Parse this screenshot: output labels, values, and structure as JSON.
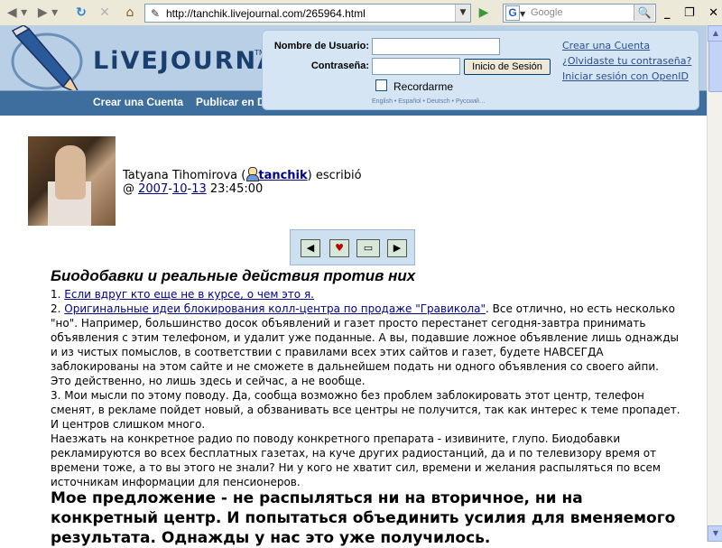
{
  "browser": {
    "url": "http://tanchik.livejournal.com/265964.html",
    "search_placeholder": "Google",
    "search_engine_letter": "G"
  },
  "header": {
    "logo": "LiVEJOURNAL",
    "logo_tm": "TM",
    "nav": [
      "Crear una Cuenta",
      "Publicar en D"
    ]
  },
  "login": {
    "username_label": "Nombre de Usuario:",
    "password_label": "Contraseña:",
    "login_button": "Inicio de Sesión",
    "remember_label": "Recordarme",
    "languages": "English • Español • Deutsch • Русский…",
    "links": [
      "Crear una Cuenta",
      "¿Olvidaste tu contraseña?",
      "Iniciar sesión con OpenID"
    ]
  },
  "post": {
    "author": "Tatyana Tihomirova (",
    "username": "tanchik",
    "wrote": ") escribió",
    "date_prefix": "@ ",
    "year": "2007",
    "month": "10",
    "day": "13",
    "time": "23:45:00",
    "title": "Биодобавки и реальные действия против них",
    "item1_num": "1. ",
    "item1_link": "Если вдруг кто еще не в курсе, о чем это я.",
    "item2_num": "2. ",
    "item2_link": "Оригинальные идеи блокирования колл-центра по продаже \"Гравикола\"",
    "item2_text": ". Все отлично, но есть несколько \"но\". Например, большинство досок объявлений и газет просто перестанет сегодня-завтра принимать объявления с этим телефоном, и удалит уже поданные. А вы, подавшие ложное объявление лишь однажды и из чистых помыслов, в соответствии с правилами всех этих сайтов и газет, будете НАВСЕГДА заблокированы на этом сайте и не сможете в дальнейшем подать ни одного объявления со своего айпи. Это действенно, но лишь здесь и сейчас, а не вообще.",
    "item3": "3. Мои мысли по этому поводу. Да, сообща возможно без проблем заблокировать этот центр, телефон сменят, в рекламе пойдет новый, а обзванивать все центры не получится, так как интерес к теме пропадет. И центров слишком много.",
    "paragraph": "Наезжать на конкретное радио по поводу конкретного препарата - изивините, глупо. Биодобавки рекламируются во всех бесплатных газетах, на куче других радиостанций, да и по телевизору время от времени тоже, а то вы этого не знали? Ни у кого не хватит сил, времени и желания распыляться по всем источникам информации для пенсионеров.",
    "bold_text": "Мое предложение - не распыляться ни на вторичное, ни на конкретный центр. И попытаться объединить усилия для вменяемого результата. Однажды у нас это уже получилось."
  }
}
